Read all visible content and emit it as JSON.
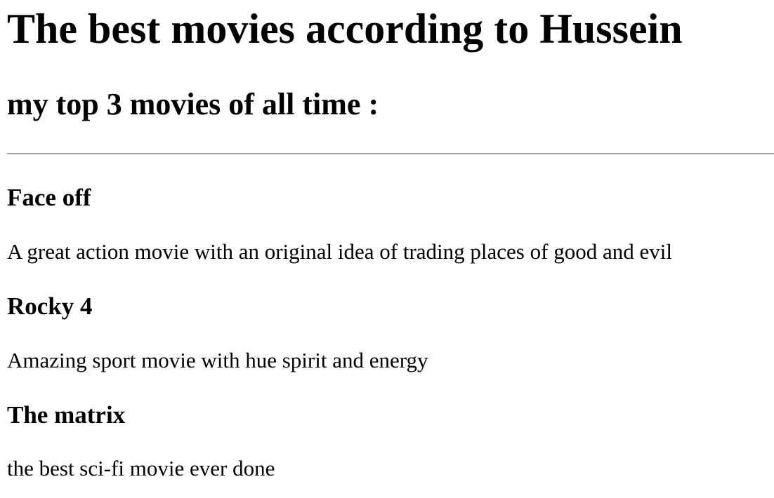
{
  "page": {
    "title": "The best movies according to Hussein",
    "subtitle": "my top 3 movies of all time :"
  },
  "movies": [
    {
      "title": "Face off",
      "description": "A great action movie with an original idea of trading places of good and evil"
    },
    {
      "title": "Rocky 4",
      "description": "Amazing sport movie with hue spirit and energy"
    },
    {
      "title": "The matrix",
      "description": "the best sci-fi movie ever done"
    }
  ]
}
